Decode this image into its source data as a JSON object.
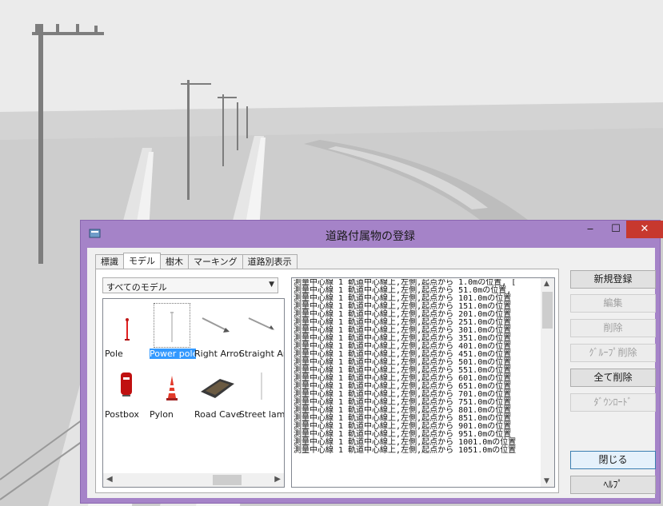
{
  "window": {
    "title": "道路付属物の登録",
    "minimize": "‒",
    "maximize": "☐",
    "close": "✕"
  },
  "tabs": [
    "標識",
    "モデル",
    "樹木",
    "マーキング",
    "道路別表示"
  ],
  "active_tab": 1,
  "filter": {
    "selected": "すべてのモデル"
  },
  "models": [
    {
      "label": "Pole",
      "icon": "pole-icon"
    },
    {
      "label": "Power pole",
      "icon": "power-pole-icon",
      "selected": true
    },
    {
      "label": "Right Arrow",
      "icon": "right-arrow-icon"
    },
    {
      "label": "Straight Arrow",
      "icon": "straight-arrow-icon"
    },
    {
      "label": "Postbox",
      "icon": "postbox-icon"
    },
    {
      "label": "Pylon",
      "icon": "pylon-icon"
    },
    {
      "label": "Road Cave",
      "icon": "road-cave-icon"
    },
    {
      "label": "Street lamp",
      "icon": "street-lamp-icon"
    }
  ],
  "log": [
    "測量中心線 1 軌道中心線上,左側,起点から 1.0mの位置, [",
    "測量中心線 1 軌道中心線上,左側,起点から 51.0mの位置,",
    "測量中心線 1 軌道中心線上,左側,起点から 101.0mの位置",
    "測量中心線 1 軌道中心線上,左側,起点から 151.0mの位置",
    "測量中心線 1 軌道中心線上,左側,起点から 201.0mの位置",
    "測量中心線 1 軌道中心線上,左側,起点から 251.0mの位置",
    "測量中心線 1 軌道中心線上,左側,起点から 301.0mの位置",
    "測量中心線 1 軌道中心線上,左側,起点から 351.0mの位置",
    "測量中心線 1 軌道中心線上,左側,起点から 401.0mの位置",
    "測量中心線 1 軌道中心線上,左側,起点から 451.0mの位置",
    "測量中心線 1 軌道中心線上,左側,起点から 501.0mの位置",
    "測量中心線 1 軌道中心線上,左側,起点から 551.0mの位置",
    "測量中心線 1 軌道中心線上,左側,起点から 601.0mの位置",
    "測量中心線 1 軌道中心線上,左側,起点から 651.0mの位置",
    "測量中心線 1 軌道中心線上,左側,起点から 701.0mの位置",
    "測量中心線 1 軌道中心線上,左側,起点から 751.0mの位置",
    "測量中心線 1 軌道中心線上,左側,起点から 801.0mの位置",
    "測量中心線 1 軌道中心線上,左側,起点から 851.0mの位置",
    "測量中心線 1 軌道中心線上,左側,起点から 901.0mの位置",
    "測量中心線 1 軌道中心線上,左側,起点から 951.0mの位置",
    "測量中心線 1 軌道中心線上,左側,起点から 1001.0mの位置",
    "測量中心線 1 軌道中心線上,左側,起点から 1051.0mの位置"
  ],
  "buttons": {
    "register": "新規登録",
    "edit": "編集",
    "delete": "削除",
    "group_delete": "ｸﾞﾙｰﾌﾟ削除",
    "delete_all": "全て削除",
    "download": "ﾀﾞｳﾝﾛｰﾄﾞ",
    "close": "閉じる",
    "help": "ﾍﾙﾌﾟ"
  },
  "colors": {
    "titlebar": "#a583c8",
    "close_button": "#c7382e",
    "selection": "#3399ff"
  }
}
